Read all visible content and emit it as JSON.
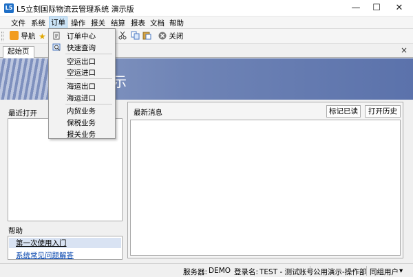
{
  "window": {
    "icon_text": "L5",
    "title": "L5立刻国际物流云管理系统 演示版",
    "minimize": "—",
    "maximize": "☐",
    "close": "✕"
  },
  "menubar": {
    "items": [
      "文件",
      "系统",
      "订单",
      "操作",
      "报关",
      "结算",
      "报表",
      "文档",
      "帮助"
    ],
    "active": "订单"
  },
  "toolbar": {
    "nav_label": "导航",
    "close_label": "关闭",
    "colors": {
      "nav": "#f29c1f",
      "star": "#f1c40f",
      "close": "#666666"
    }
  },
  "tabs": {
    "start_tab": "起始页",
    "close": "×"
  },
  "banner": {
    "text": "示"
  },
  "left_panel": {
    "recent_title": "最近打开",
    "help_title": "帮助",
    "help_links": [
      "第一次使用入门",
      "系统常见问题解答"
    ]
  },
  "right_panel": {
    "news_title": "最新消息",
    "mark_read": "标记已读",
    "open_history": "打开历史"
  },
  "statusbar": {
    "server_label": "服务器:",
    "server_value": "DEMO",
    "login_label": "登录名:",
    "login_value": "TEST - 测试账号",
    "company": "公用演示-操作部",
    "group": "同组用户",
    "dropdown_arrow": "▾"
  },
  "order_menu": {
    "items": [
      "订单中心",
      "快速查询",
      "空运出口",
      "空运进口",
      "海运出口",
      "海运进口",
      "内贸业务",
      "保税业务",
      "报关业务"
    ]
  }
}
